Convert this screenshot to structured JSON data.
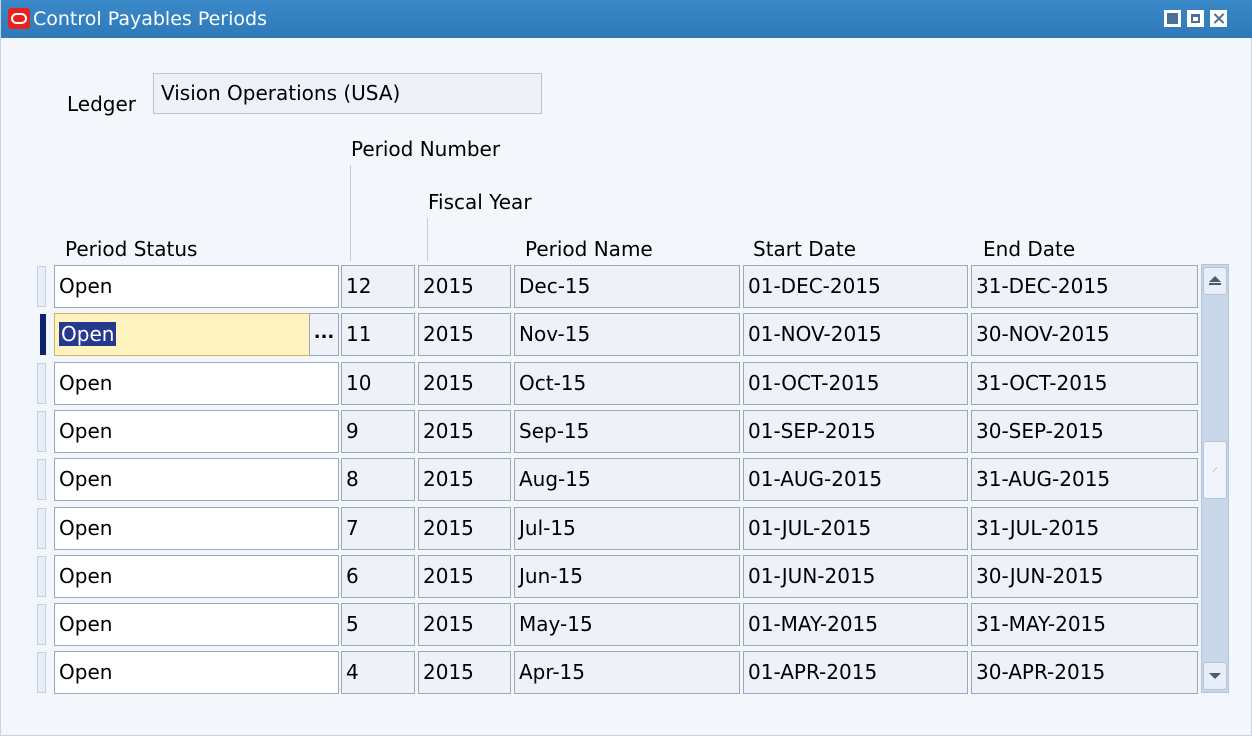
{
  "window": {
    "title": "Control Payables Periods",
    "colors": {
      "titlebar": "#2e79b9",
      "background": "#f3f6fb",
      "current_record": "#fff4c0",
      "selection": "#253a8e",
      "row_indicator": "#0d2273"
    },
    "controls": [
      "minimize-icon",
      "maximize-icon",
      "close-icon"
    ]
  },
  "ledger": {
    "label": "Ledger",
    "value": "Vision Operations (USA)"
  },
  "table": {
    "headers": {
      "period_number": "Period Number",
      "fiscal_year": "Fiscal Year",
      "period_status": "Period Status",
      "period_name": "Period Name",
      "start_date": "Start Date",
      "end_date": "End Date"
    },
    "lov_button": "...",
    "rows": [
      {
        "status": "Open",
        "period_number": "12",
        "fiscal_year": "2015",
        "period_name": "Dec-15",
        "start_date": "01-DEC-2015",
        "end_date": "31-DEC-2015",
        "current": false
      },
      {
        "status": "Open",
        "period_number": "11",
        "fiscal_year": "2015",
        "period_name": "Nov-15",
        "start_date": "01-NOV-2015",
        "end_date": "30-NOV-2015",
        "current": true
      },
      {
        "status": "Open",
        "period_number": "10",
        "fiscal_year": "2015",
        "period_name": "Oct-15",
        "start_date": "01-OCT-2015",
        "end_date": "31-OCT-2015",
        "current": false
      },
      {
        "status": "Open",
        "period_number": "9",
        "fiscal_year": "2015",
        "period_name": "Sep-15",
        "start_date": "01-SEP-2015",
        "end_date": "30-SEP-2015",
        "current": false
      },
      {
        "status": "Open",
        "period_number": "8",
        "fiscal_year": "2015",
        "period_name": "Aug-15",
        "start_date": "01-AUG-2015",
        "end_date": "31-AUG-2015",
        "current": false
      },
      {
        "status": "Open",
        "period_number": "7",
        "fiscal_year": "2015",
        "period_name": "Jul-15",
        "start_date": "01-JUL-2015",
        "end_date": "31-JUL-2015",
        "current": false
      },
      {
        "status": "Open",
        "period_number": "6",
        "fiscal_year": "2015",
        "period_name": "Jun-15",
        "start_date": "01-JUN-2015",
        "end_date": "30-JUN-2015",
        "current": false
      },
      {
        "status": "Open",
        "period_number": "5",
        "fiscal_year": "2015",
        "period_name": "May-15",
        "start_date": "01-MAY-2015",
        "end_date": "31-MAY-2015",
        "current": false
      },
      {
        "status": "Open",
        "period_number": "4",
        "fiscal_year": "2015",
        "period_name": "Apr-15",
        "start_date": "01-APR-2015",
        "end_date": "30-APR-2015",
        "current": false
      }
    ]
  }
}
